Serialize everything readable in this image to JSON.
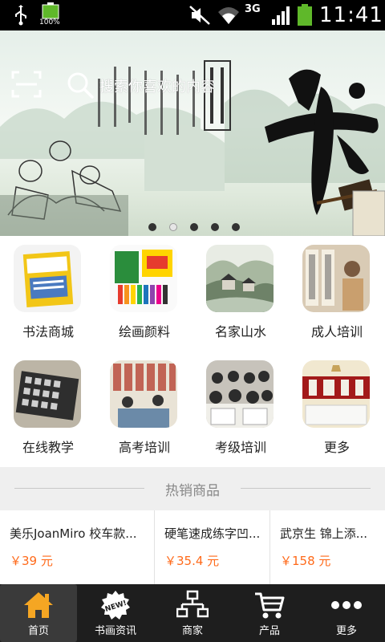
{
  "status_bar": {
    "battery_small_label": "100%",
    "network_type": "3G",
    "time": "11:41"
  },
  "banner": {
    "search_placeholder": "搜索你喜欢的内容",
    "slide_count": 5,
    "active_slide": 2
  },
  "categories": [
    {
      "label": "书法商城",
      "icon": "calligraphy-book-thumb"
    },
    {
      "label": "绘画颜料",
      "icon": "paint-supplies-thumb"
    },
    {
      "label": "名家山水",
      "icon": "landscape-painting-thumb"
    },
    {
      "label": "成人培训",
      "icon": "adult-training-thumb"
    },
    {
      "label": "在线教学",
      "icon": "online-teaching-thumb"
    },
    {
      "label": "高考培训",
      "icon": "exam-training-thumb"
    },
    {
      "label": "考级培训",
      "icon": "grade-exam-thumb"
    },
    {
      "label": "更多",
      "icon": "more-thumb"
    }
  ],
  "hot_section": {
    "title": "热销商品"
  },
  "products": [
    {
      "name": "美乐JoanMiro 校车款...",
      "price": "￥39 元"
    },
    {
      "name": "硬笔速成练字凹...",
      "price": "￥35.4 元"
    },
    {
      "name": "武京生 锦上添...",
      "price": "￥158 元"
    }
  ],
  "tabs": [
    {
      "label": "首页",
      "icon": "home-icon",
      "active": true
    },
    {
      "label": "书画资讯",
      "icon": "news-icon",
      "active": false
    },
    {
      "label": "商家",
      "icon": "merchant-icon",
      "active": false
    },
    {
      "label": "产品",
      "icon": "cart-icon",
      "active": false
    },
    {
      "label": "更多",
      "icon": "more-dots-icon",
      "active": false
    }
  ],
  "colors": {
    "price": "#ff6a1a",
    "tabbar_bg": "#1e1e1e",
    "tab_active_bg": "#3a3a3a",
    "home_icon": "#f5a623"
  }
}
